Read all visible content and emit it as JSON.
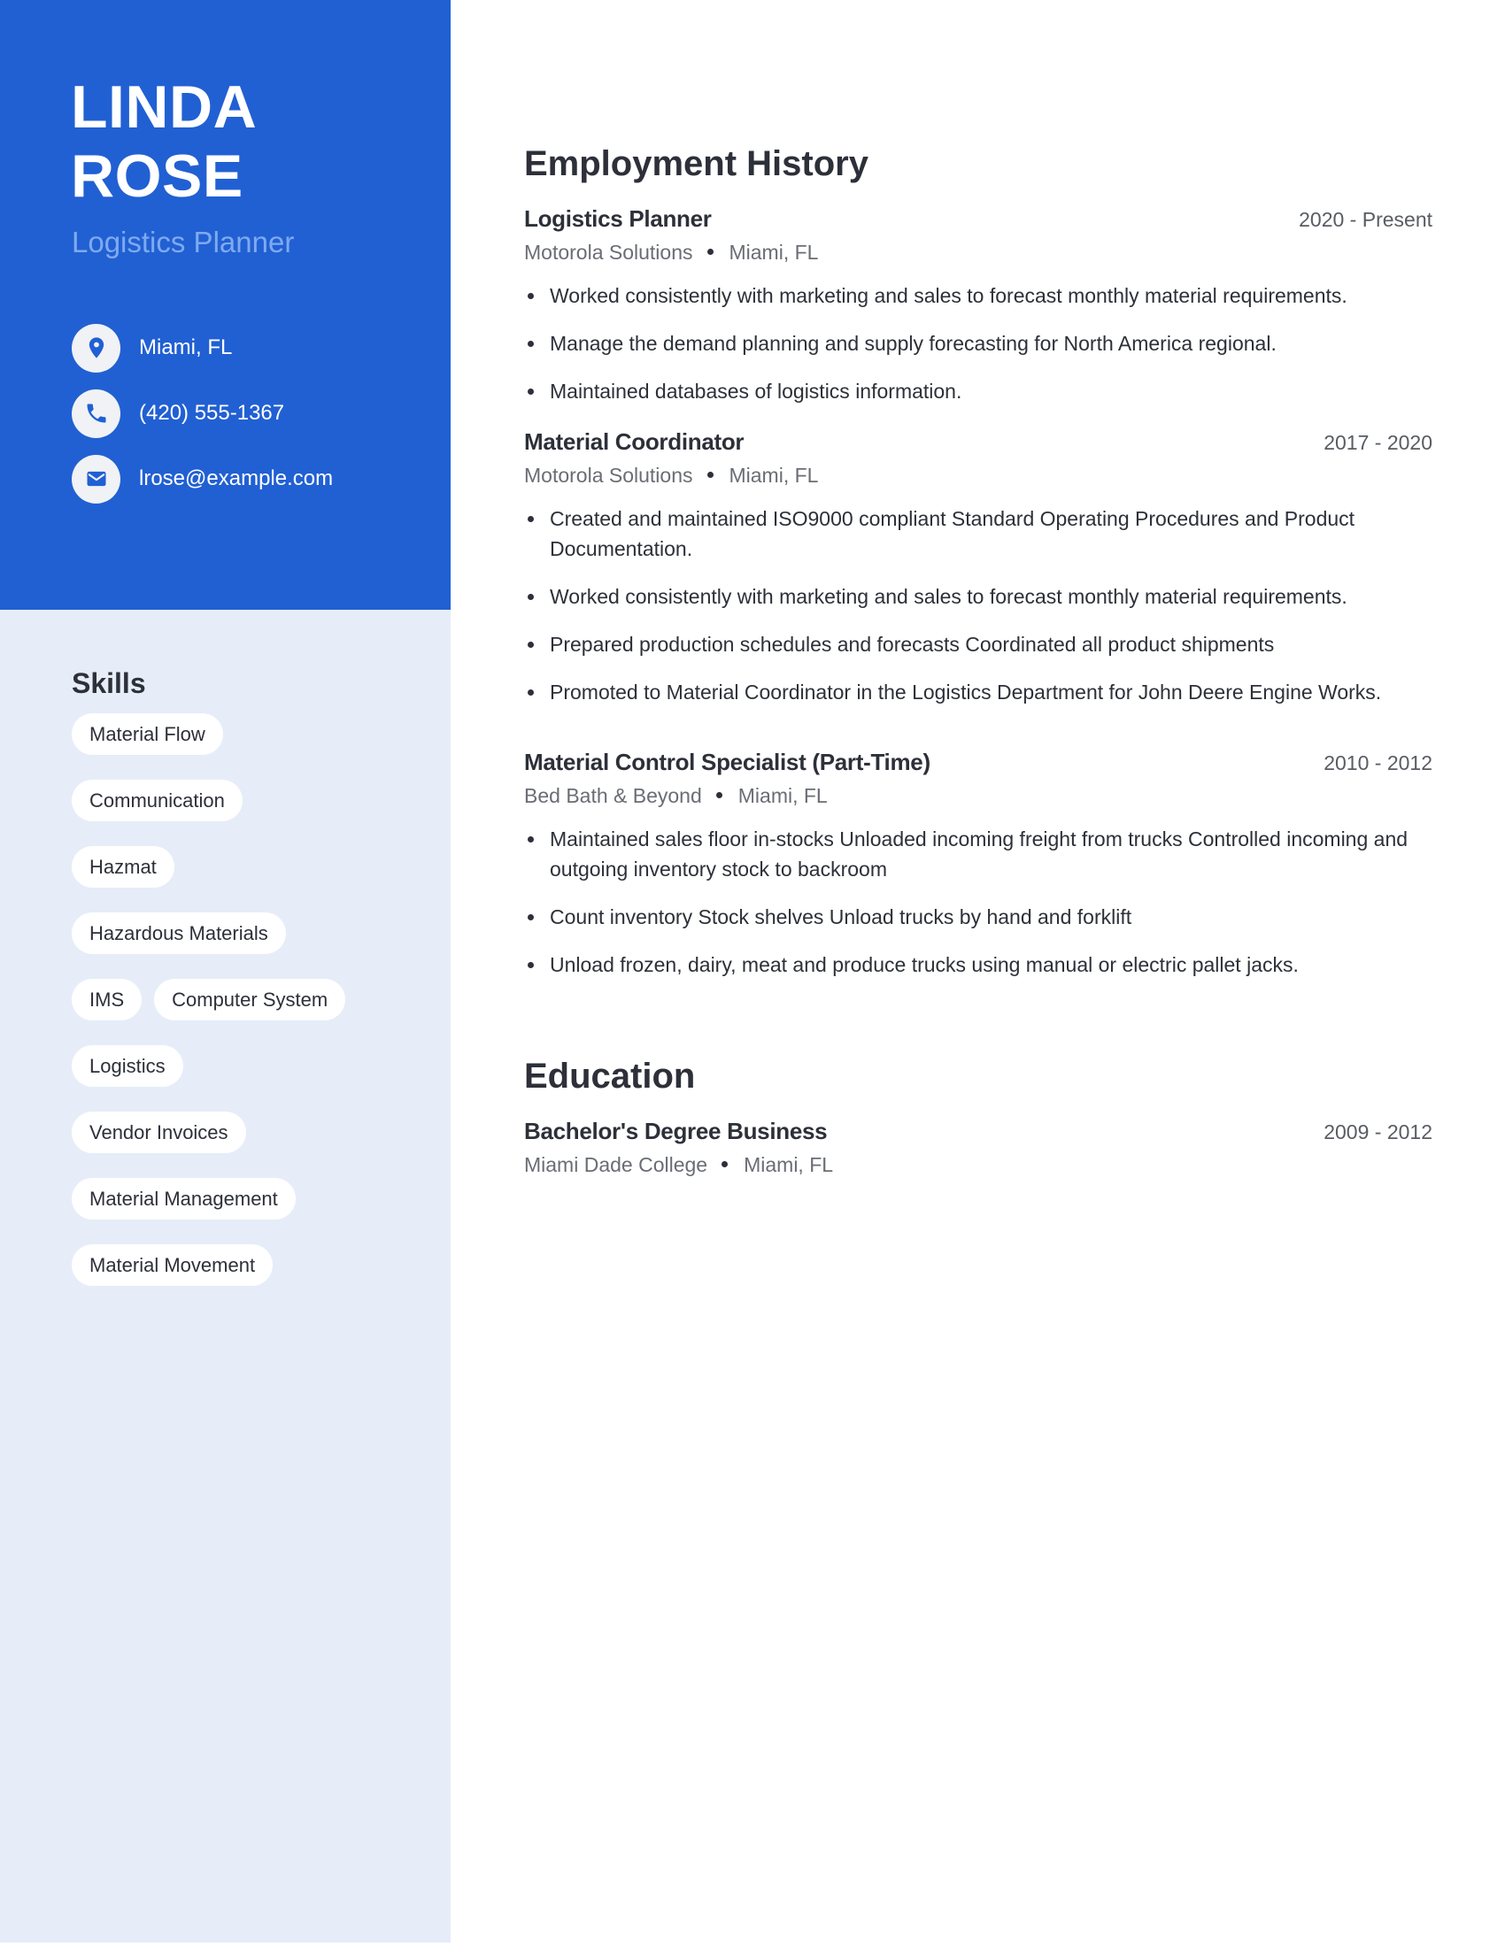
{
  "profile": {
    "first_name": "LINDA",
    "last_name": "ROSE",
    "role": "Logistics Planner"
  },
  "contacts": [
    {
      "icon": "location-pin-icon",
      "text": "Miami, FL"
    },
    {
      "icon": "phone-icon",
      "text": "(420) 555-1367"
    },
    {
      "icon": "email-icon",
      "text": "lrose@example.com"
    }
  ],
  "skills": {
    "title": "Skills",
    "items": [
      "Material Flow",
      "Communication",
      "Hazmat",
      "Hazardous Materials",
      "IMS",
      "Computer System",
      "Logistics",
      "Vendor Invoices",
      "Material Management",
      "Material Movement"
    ]
  },
  "employment": {
    "title": "Employment History",
    "jobs": [
      {
        "title": "Logistics Planner",
        "date": "2020 - Present",
        "company": "Motorola Solutions",
        "location": "Miami, FL",
        "bullets": [
          "Worked consistently with marketing and sales to forecast monthly material requirements.",
          "Manage the demand planning and supply forecasting for North America regional.",
          "Maintained databases of logistics information."
        ]
      },
      {
        "title": "Material Coordinator",
        "date": "2017 - 2020",
        "company": "Motorola Solutions",
        "location": "Miami, FL",
        "bullets": [
          "Created and maintained ISO9000 compliant Standard Operating Procedures and Product Documentation.",
          "Worked consistently with marketing and sales to forecast monthly material requirements.",
          "Prepared production schedules and forecasts Coordinated all product shipments",
          "Promoted to Material Coordinator in the Logistics Department for John Deere Engine Works."
        ]
      },
      {
        "title": "Material Control Specialist (Part-Time)",
        "date": "2010 - 2012",
        "company": "Bed Bath & Beyond",
        "location": "Miami, FL",
        "bullets": [
          "Maintained sales floor in-stocks Unloaded incoming freight from trucks Controlled incoming and outgoing inventory stock to backroom",
          "Count inventory Stock shelves Unload trucks by hand and forklift",
          "Unload frozen, dairy, meat and produce trucks using manual or electric pallet jacks."
        ]
      }
    ]
  },
  "education": {
    "title": "Education",
    "entries": [
      {
        "degree": "Bachelor's Degree Business",
        "date": "2009 - 2012",
        "school": "Miami Dade College",
        "location": "Miami, FL"
      }
    ]
  },
  "colors": {
    "sidebar_accent": "#2160D3",
    "sidebar_light": "#E6EDF8",
    "role_text": "#7FAAF0",
    "heading_text": "#2D3039",
    "muted_text": "#6A6D74"
  }
}
